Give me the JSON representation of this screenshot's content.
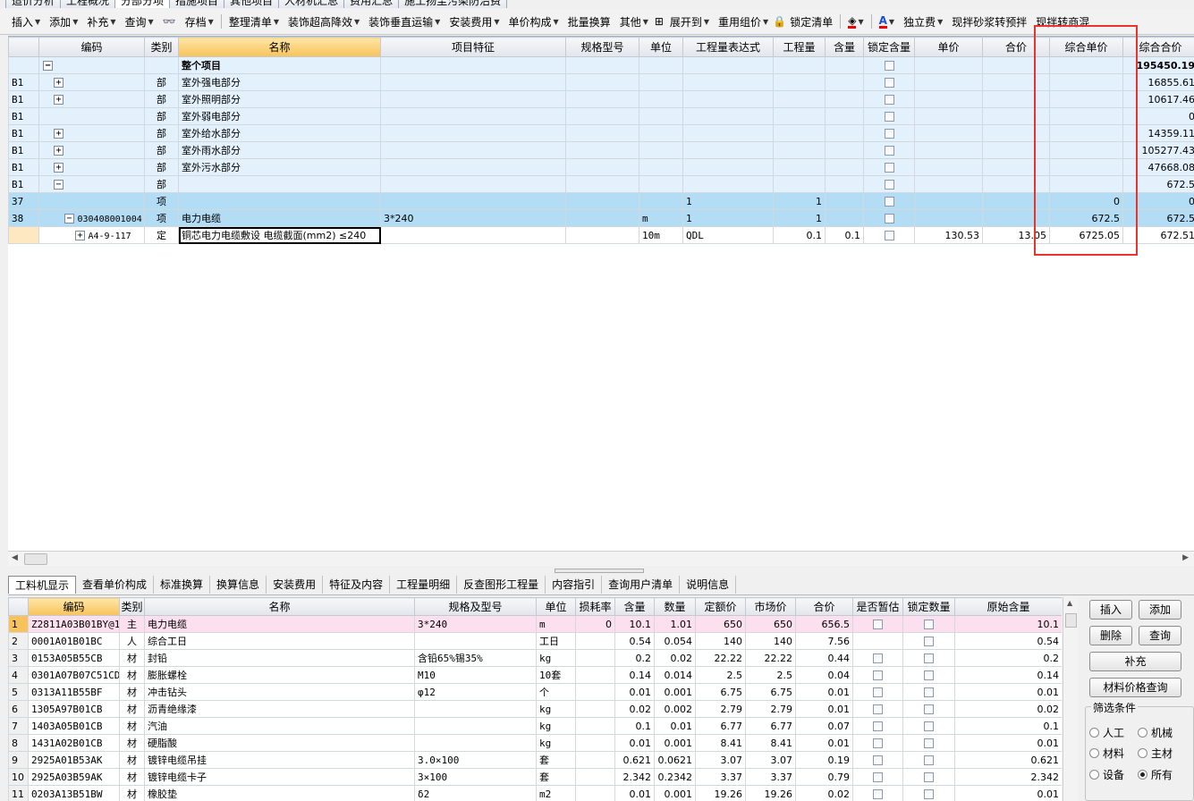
{
  "top_tabs": [
    "造价分析",
    "工程概况",
    "分部分项",
    "措施项目",
    "其他项目",
    "人材机汇总",
    "费用汇总",
    "施工扬尘污染防治费"
  ],
  "toolbar": [
    {
      "label": "插入",
      "caret": true
    },
    {
      "label": "添加",
      "caret": true
    },
    {
      "label": "补充",
      "caret": true
    },
    {
      "label": "查询",
      "caret": true
    },
    {
      "label": "存档",
      "caret": true
    },
    {
      "label": "整理清单",
      "caret": true
    },
    {
      "label": "装饰超高降效",
      "caret": true
    },
    {
      "label": "装饰垂直运输",
      "caret": true
    },
    {
      "label": "安装费用",
      "caret": true
    },
    {
      "label": "单价构成",
      "caret": true
    },
    {
      "label": "批量换算",
      "caret": false
    },
    {
      "label": "其他",
      "caret": true
    },
    {
      "label": "展开到",
      "caret": true
    },
    {
      "label": "重用组价",
      "caret": true
    },
    {
      "label": "锁定清单",
      "caret": false
    },
    {
      "label": "独立费",
      "caret": true
    },
    {
      "label": "现拌砂浆转预拌",
      "caret": false
    },
    {
      "label": "现拌转商混",
      "caret": false
    }
  ],
  "upper": {
    "headers": [
      "编码",
      "类别",
      "名称",
      "项目特征",
      "规格型号",
      "单位",
      "工程量表达式",
      "工程量",
      "含量",
      "锁定含量",
      "单价",
      "合价",
      "综合单价",
      "综合合价"
    ],
    "rows": [
      {
        "style": "top",
        "no": "",
        "code": "",
        "type": "",
        "name": "整个项目",
        "feature": "",
        "unit": "",
        "expr": "",
        "qty": "",
        "content": "",
        "price": "",
        "total": "",
        "uprice": "",
        "utotal": "195450.19",
        "exp": "minus",
        "indent": 0
      },
      {
        "style": "light",
        "no": "B1",
        "code": "",
        "type": "部",
        "name": "室外强电部分",
        "feature": "",
        "unit": "",
        "expr": "",
        "qty": "",
        "content": "",
        "price": "",
        "total": "",
        "uprice": "",
        "utotal": "16855.61",
        "exp": "plus",
        "indent": 1
      },
      {
        "style": "light",
        "no": "B1",
        "code": "",
        "type": "部",
        "name": "室外照明部分",
        "feature": "",
        "unit": "",
        "expr": "",
        "qty": "",
        "content": "",
        "price": "",
        "total": "",
        "uprice": "",
        "utotal": "10617.46",
        "exp": "plus",
        "indent": 1
      },
      {
        "style": "light",
        "no": "B1",
        "code": "",
        "type": "部",
        "name": "室外弱电部分",
        "feature": "",
        "unit": "",
        "expr": "",
        "qty": "",
        "content": "",
        "price": "",
        "total": "",
        "uprice": "",
        "utotal": "0",
        "exp": "none",
        "indent": 1
      },
      {
        "style": "light",
        "no": "B1",
        "code": "",
        "type": "部",
        "name": "室外给水部分",
        "feature": "",
        "unit": "",
        "expr": "",
        "qty": "",
        "content": "",
        "price": "",
        "total": "",
        "uprice": "",
        "utotal": "14359.11",
        "exp": "plus",
        "indent": 1
      },
      {
        "style": "light",
        "no": "B1",
        "code": "",
        "type": "部",
        "name": "室外雨水部分",
        "feature": "",
        "unit": "",
        "expr": "",
        "qty": "",
        "content": "",
        "price": "",
        "total": "",
        "uprice": "",
        "utotal": "105277.43",
        "exp": "plus",
        "indent": 1
      },
      {
        "style": "light",
        "no": "B1",
        "code": "",
        "type": "部",
        "name": "室外污水部分",
        "feature": "",
        "unit": "",
        "expr": "",
        "qty": "",
        "content": "",
        "price": "",
        "total": "",
        "uprice": "",
        "utotal": "47668.08",
        "exp": "plus",
        "indent": 1
      },
      {
        "style": "light",
        "no": "B1",
        "code": "",
        "type": "部",
        "name": "",
        "feature": "",
        "unit": "",
        "expr": "",
        "qty": "",
        "content": "",
        "price": "",
        "total": "",
        "uprice": "",
        "utotal": "672.5",
        "exp": "minus",
        "indent": 1
      },
      {
        "style": "blue",
        "no": "37",
        "code": "",
        "type": "项",
        "name": "",
        "feature": "",
        "unit": "",
        "expr": "1",
        "qty": "1",
        "content": "",
        "price": "",
        "total": "",
        "uprice": "0",
        "utotal": "0",
        "exp": "none",
        "indent": 2
      },
      {
        "style": "blue",
        "no": "38",
        "code": "030408001004",
        "type": "项",
        "name": "电力电缆",
        "feature": "3*240",
        "unit": "m",
        "expr": "1",
        "qty": "1",
        "content": "",
        "price": "",
        "total": "",
        "uprice": "672.5",
        "utotal": "672.5",
        "exp": "minus",
        "indent": 2
      },
      {
        "style": "white",
        "no": "",
        "code": "A4-9-117",
        "type": "定",
        "name": "铜芯电力电缆敷设 电缆截面(mm2) ≤240",
        "feature": "",
        "unit": "10m",
        "expr": "QDL",
        "qty": "0.1",
        "content": "0.1",
        "price": "130.53",
        "total": "13.05",
        "uprice": "6725.05",
        "utotal": "672.51",
        "exp": "plus",
        "indent": 3
      }
    ]
  },
  "subtabs": [
    "工料机显示",
    "查看单价构成",
    "标准换算",
    "换算信息",
    "安装费用",
    "特征及内容",
    "工程量明细",
    "反查图形工程量",
    "内容指引",
    "查询用户清单",
    "说明信息"
  ],
  "lower": {
    "headers": [
      "",
      "编码",
      "类别",
      "名称",
      "规格及型号",
      "单位",
      "损耗率",
      "含量",
      "数量",
      "定额价",
      "市场价",
      "合价",
      "是否暂估",
      "锁定数量",
      "原始含量"
    ],
    "rows": [
      {
        "n": "1",
        "code": "Z2811A03B01BY@1",
        "type": "主",
        "name": "电力电缆",
        "spec": "3*240",
        "unit": "m",
        "loss": "0",
        "content": "10.1",
        "qty": "1.01",
        "base": "650",
        "market": "650",
        "total": "656.5",
        "est": true,
        "orig": "10.1"
      },
      {
        "n": "2",
        "code": "0001A01B01BC",
        "type": "人",
        "name": "综合工日",
        "spec": "",
        "unit": "工日",
        "loss": "",
        "content": "0.54",
        "qty": "0.054",
        "base": "140",
        "market": "140",
        "total": "7.56",
        "est": false,
        "orig": "0.54"
      },
      {
        "n": "3",
        "code": "0153A05B55CB",
        "type": "材",
        "name": "封铅",
        "spec": "含铅65%锡35%",
        "unit": "kg",
        "loss": "",
        "content": "0.2",
        "qty": "0.02",
        "base": "22.22",
        "market": "22.22",
        "total": "0.44",
        "est": true,
        "orig": "0.2"
      },
      {
        "n": "4",
        "code": "0301A07B07C51CD",
        "type": "材",
        "name": "膨胀螺栓",
        "spec": "M10",
        "unit": "10套",
        "loss": "",
        "content": "0.14",
        "qty": "0.014",
        "base": "2.5",
        "market": "2.5",
        "total": "0.04",
        "est": true,
        "orig": "0.14"
      },
      {
        "n": "5",
        "code": "0313A11B55BF",
        "type": "材",
        "name": "冲击钻头",
        "spec": "φ12",
        "unit": "个",
        "loss": "",
        "content": "0.01",
        "qty": "0.001",
        "base": "6.75",
        "market": "6.75",
        "total": "0.01",
        "est": true,
        "orig": "0.01"
      },
      {
        "n": "6",
        "code": "1305A97B01CB",
        "type": "材",
        "name": "沥青绝缘漆",
        "spec": "",
        "unit": "kg",
        "loss": "",
        "content": "0.02",
        "qty": "0.002",
        "base": "2.79",
        "market": "2.79",
        "total": "0.01",
        "est": true,
        "orig": "0.02"
      },
      {
        "n": "7",
        "code": "1403A05B01CB",
        "type": "材",
        "name": "汽油",
        "spec": "",
        "unit": "kg",
        "loss": "",
        "content": "0.1",
        "qty": "0.01",
        "base": "6.77",
        "market": "6.77",
        "total": "0.07",
        "est": true,
        "orig": "0.1"
      },
      {
        "n": "8",
        "code": "1431A02B01CB",
        "type": "材",
        "name": "硬脂酸",
        "spec": "",
        "unit": "kg",
        "loss": "",
        "content": "0.01",
        "qty": "0.001",
        "base": "8.41",
        "market": "8.41",
        "total": "0.01",
        "est": true,
        "orig": "0.01"
      },
      {
        "n": "9",
        "code": "2925A01B53AK",
        "type": "材",
        "name": "镀锌电缆吊挂",
        "spec": "3.0×100",
        "unit": "套",
        "loss": "",
        "content": "0.621",
        "qty": "0.0621",
        "base": "3.07",
        "market": "3.07",
        "total": "0.19",
        "est": true,
        "orig": "0.621"
      },
      {
        "n": "10",
        "code": "2925A03B59AK",
        "type": "材",
        "name": "镀锌电缆卡子",
        "spec": "3×100",
        "unit": "套",
        "loss": "",
        "content": "2.342",
        "qty": "0.2342",
        "base": "3.37",
        "market": "3.37",
        "total": "0.79",
        "est": true,
        "orig": "2.342"
      },
      {
        "n": "11",
        "code": "0203A13B51BW",
        "type": "材",
        "name": "橡胶垫",
        "spec": "δ2",
        "unit": "m2",
        "loss": "",
        "content": "0.01",
        "qty": "0.001",
        "base": "19.26",
        "market": "19.26",
        "total": "0.02",
        "est": true,
        "orig": "0.01"
      }
    ]
  },
  "right_panel": {
    "insert": "插入",
    "add": "添加",
    "delete": "删除",
    "query": "查询",
    "supplement": "补充",
    "price_query": "材料价格查询",
    "filter_title": "筛选条件",
    "filters": [
      {
        "label": "人工",
        "on": false
      },
      {
        "label": "机械",
        "on": false
      },
      {
        "label": "材料",
        "on": false
      },
      {
        "label": "主材",
        "on": false
      },
      {
        "label": "设备",
        "on": false
      },
      {
        "label": "所有",
        "on": true
      }
    ]
  },
  "colors": {
    "highlight_box": "#e8332e",
    "header_active": "#f7c35a",
    "row_light": "#e3f1fc",
    "row_blue": "#b3dcf5"
  }
}
